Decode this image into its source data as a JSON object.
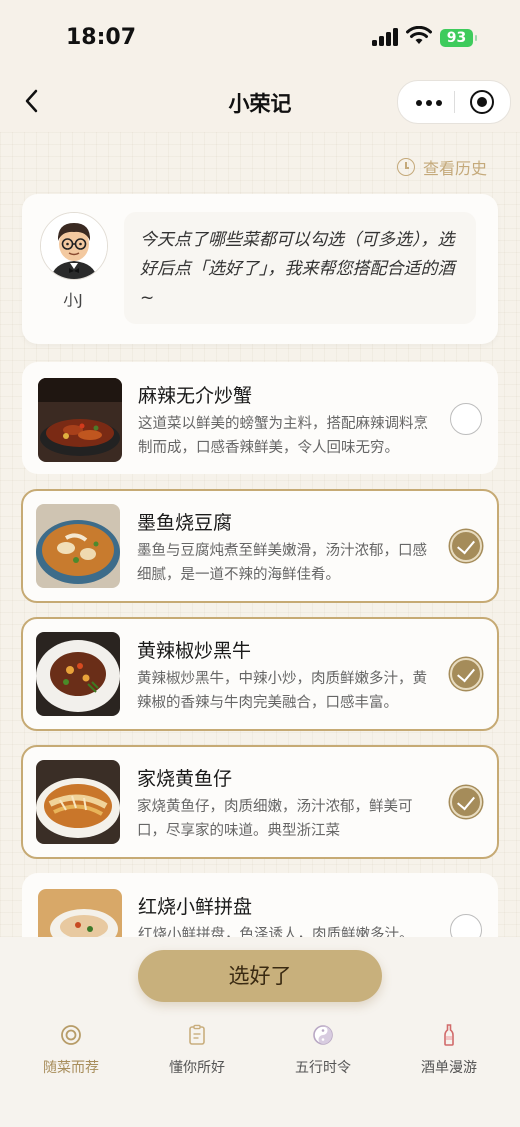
{
  "status_bar": {
    "time": "18:07",
    "battery": "93"
  },
  "nav": {
    "title": "小荣记"
  },
  "history_link": "查看历史",
  "assistant": {
    "name": "小J",
    "message": "今天点了哪些菜都可以勾选（可多选），选好后点「选好了」，我来帮您搭配合适的酒~"
  },
  "dishes": [
    {
      "name": "麻辣无介炒蟹",
      "desc": "这道菜以鲜美的螃蟹为主料，搭配麻辣调料烹制而成，口感香辣鲜美，令人回味无穷。",
      "selected": false
    },
    {
      "name": "墨鱼烧豆腐",
      "desc": "墨鱼与豆腐炖煮至鲜美嫩滑，汤汁浓郁，口感细腻，是一道不辣的海鲜佳肴。",
      "selected": true
    },
    {
      "name": "黄辣椒炒黑牛",
      "desc": "黄辣椒炒黑牛，中辣小炒，肉质鲜嫩多汁，黄辣椒的香辣与牛肉完美融合，口感丰富。",
      "selected": true
    },
    {
      "name": "家烧黄鱼仔",
      "desc": "家烧黄鱼仔，肉质细嫩，汤汁浓郁，鲜美可口，尽享家的味道。典型浙江菜",
      "selected": true
    },
    {
      "name": "红烧小鲜拼盘",
      "desc": "红烧小鲜拼盘，色泽诱人，肉质鲜嫩多汁。",
      "selected": false
    }
  ],
  "cta_label": "选好了",
  "tabs": [
    {
      "label": "随菜而荐",
      "active": true
    },
    {
      "label": "懂你所好",
      "active": false
    },
    {
      "label": "五行时令",
      "active": false
    },
    {
      "label": "酒单漫游",
      "active": false
    }
  ],
  "colors": {
    "accent": "#c8b07c",
    "selected_border": "#c6aa74",
    "active_tab": "#a88e5c"
  }
}
